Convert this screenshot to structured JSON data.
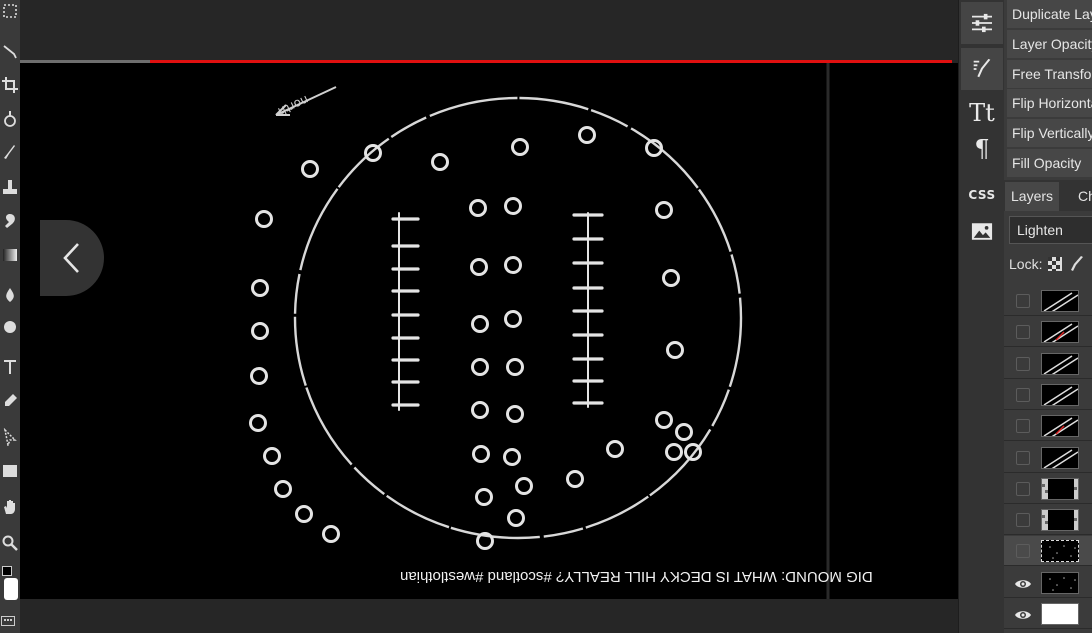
{
  "left_toolbar": {
    "tools": [
      "marquee-tool-icon",
      "lasso-tool-icon",
      "crop-tool-icon",
      "heal-tool-icon",
      "brush-tool-icon",
      "stamp-tool-icon",
      "spot-tool-icon",
      "gradient-tool-icon",
      "dodge-tool-icon",
      "blur-tool-icon",
      "type-tool-icon",
      "pen-tool-icon",
      "path-select-tool-icon",
      "shape-tool-icon",
      "hand-tool-icon",
      "zoom-tool-icon"
    ],
    "foreground_color": "#000000",
    "background_color": "#ffffff"
  },
  "video": {
    "caption": "DIG MOUND: WHAT IS DECKY HILL REALLY? #scotland #westlothian",
    "arrow_label": "north",
    "progress_fraction": 0.14,
    "progress_color": "#e01010"
  },
  "icon_strip": {
    "items": [
      {
        "name": "adjustments-icon"
      },
      {
        "name": "brush-settings-icon"
      },
      {
        "name": "character-icon",
        "text": "Tt"
      },
      {
        "name": "paragraph-icon",
        "text": "¶"
      },
      {
        "name": "css-icon",
        "text": "CSS"
      },
      {
        "name": "image-icon"
      }
    ]
  },
  "panel": {
    "menu": [
      "Duplicate Layer",
      "Layer Opacity",
      "Free Transform",
      "Flip Horizontal",
      "Flip Vertically",
      "Fill Opacity"
    ],
    "tabs": [
      "Layers",
      "Channels"
    ],
    "blend_mode": "Lighten",
    "lock_label": "Lock:",
    "layers": [
      {
        "visible": false,
        "thumb": "dark-diagonal"
      },
      {
        "visible": false,
        "thumb": "dark-diagonal-red"
      },
      {
        "visible": false,
        "thumb": "dark-diagonal"
      },
      {
        "visible": false,
        "thumb": "dark-diagonal"
      },
      {
        "visible": false,
        "thumb": "dark-diagonal-red"
      },
      {
        "visible": false,
        "thumb": "dark-diagonal"
      },
      {
        "visible": false,
        "thumb": "dark-checker"
      },
      {
        "visible": false,
        "thumb": "dark-checker"
      },
      {
        "visible": false,
        "thumb": "dark-speckle",
        "selected": true
      },
      {
        "visible": true,
        "thumb": "dark-speckle"
      },
      {
        "visible": true,
        "thumb": "white"
      }
    ]
  }
}
